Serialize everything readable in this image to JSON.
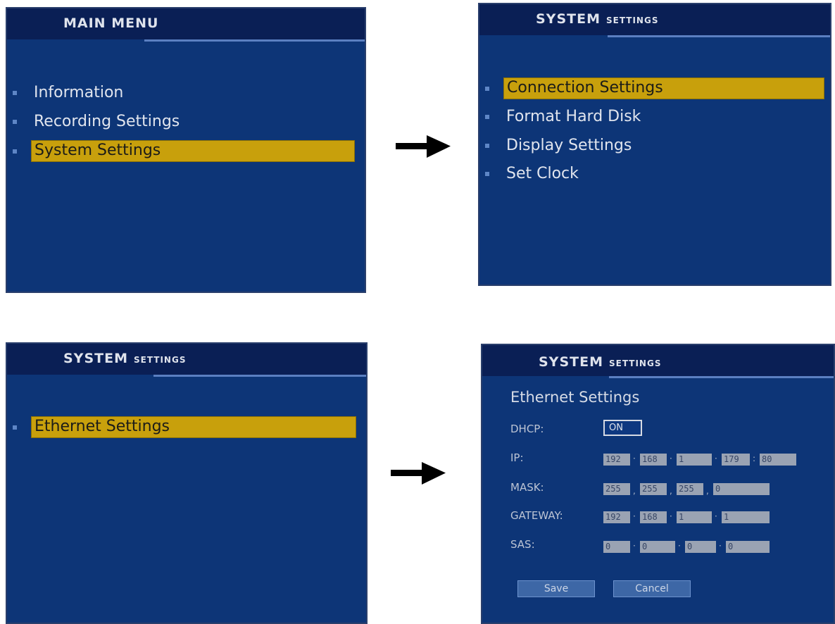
{
  "panel1": {
    "header": {
      "title": "MAIN MENU"
    },
    "items": [
      {
        "label": "Information"
      },
      {
        "label": "Recording Settings"
      },
      {
        "label": "System Settings"
      }
    ]
  },
  "panel2": {
    "header": {
      "title_big": "SYSTEM",
      "title_small": "SETTINGS"
    },
    "items": [
      {
        "label": "Connection Settings"
      },
      {
        "label": "Format Hard Disk"
      },
      {
        "label": "Display Settings"
      },
      {
        "label": "Set Clock"
      }
    ]
  },
  "panel3": {
    "header": {
      "title_big": "SYSTEM",
      "title_small": "SETTINGS"
    },
    "items": [
      {
        "label": "Ethernet Settings"
      }
    ]
  },
  "panel4": {
    "header": {
      "title_big": "SYSTEM",
      "title_small": "SETTINGS"
    },
    "section_title": "Ethernet Settings",
    "dhcp": {
      "label": "DHCP:",
      "value": "ON"
    },
    "ip": {
      "label": "IP:",
      "octets": [
        "192",
        "168",
        "1",
        "179"
      ],
      "port": "80"
    },
    "mask": {
      "label": "MASK:",
      "octets": [
        "255",
        "255",
        "255",
        "0"
      ]
    },
    "gateway": {
      "label": "GATEWAY:",
      "octets": [
        "192",
        "168",
        "1",
        "1"
      ]
    },
    "sas": {
      "label": "SAS:",
      "octets": [
        "0",
        "0",
        "0",
        "0"
      ]
    },
    "buttons": {
      "save": "Save",
      "cancel": "Cancel"
    }
  },
  "icons": {
    "arrow": "right-arrow-icon",
    "bullet": "square-bullet-icon"
  },
  "colors": {
    "screen_bg": "#0d3577",
    "header_bg": "#0a1f55",
    "selection": "#c8a00c"
  }
}
